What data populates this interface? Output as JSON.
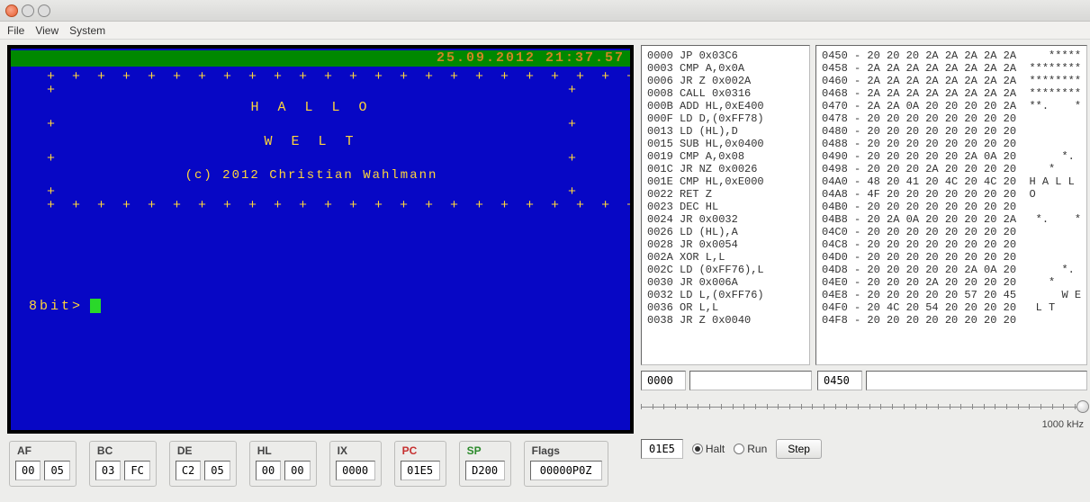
{
  "menubar": {
    "file": "File",
    "view": "View",
    "system": "System"
  },
  "screen": {
    "datetime": "25.09.2012 21:37.57",
    "line1": "H A L L O",
    "line2": "W E L T",
    "copyright": "(c) 2012 Christian Wahlmann",
    "prompt": "8bit>"
  },
  "registers": {
    "AF": {
      "label": "AF",
      "hi": "00",
      "lo": "05"
    },
    "BC": {
      "label": "BC",
      "hi": "03",
      "lo": "FC"
    },
    "DE": {
      "label": "DE",
      "hi": "C2",
      "lo": "05"
    },
    "HL": {
      "label": "HL",
      "hi": "00",
      "lo": "00"
    },
    "IX": {
      "label": "IX",
      "val": "0000"
    },
    "PC": {
      "label": "PC",
      "val": "01E5"
    },
    "SP": {
      "label": "SP",
      "val": "D200"
    },
    "Flags": {
      "label": "Flags",
      "val": "00000P0Z"
    }
  },
  "disasm": [
    "0000 JP 0x03C6",
    "0003 CMP A,0x0A",
    "0006 JR Z 0x002A",
    "0008 CALL 0x0316",
    "000B ADD HL,0xE400",
    "000F LD D,(0xFF78)",
    "0013 LD (HL),D",
    "0015 SUB HL,0x0400",
    "0019 CMP A,0x08",
    "001C JR NZ 0x0026",
    "001E CMP HL,0xE000",
    "0022 RET Z",
    "0023 DEC HL",
    "0024 JR 0x0032",
    "0026 LD (HL),A",
    "0028 JR 0x0054",
    "002A XOR L,L",
    "002C LD (0xFF76),L",
    "0030 JR 0x006A",
    "0032 LD L,(0xFF76)",
    "0036 OR L,L",
    "0038 JR Z 0x0040"
  ],
  "memdump": [
    "0450 - 20 20 20 2A 2A 2A 2A 2A     *****",
    "0458 - 2A 2A 2A 2A 2A 2A 2A 2A  ********",
    "0460 - 2A 2A 2A 2A 2A 2A 2A 2A  ********",
    "0468 - 2A 2A 2A 2A 2A 2A 2A 2A  ********",
    "0470 - 2A 2A 0A 20 20 20 20 2A  **.    *",
    "0478 - 20 20 20 20 20 20 20 20          ",
    "0480 - 20 20 20 20 20 20 20 20          ",
    "0488 - 20 20 20 20 20 20 20 20          ",
    "0490 - 20 20 20 20 20 2A 0A 20       *. ",
    "0498 - 20 20 20 2A 20 20 20 20     *    ",
    "04A0 - 48 20 41 20 4C 20 4C 20  H A L L ",
    "04A8 - 4F 20 20 20 20 20 20 20  O       ",
    "04B0 - 20 20 20 20 20 20 20 20          ",
    "04B8 - 20 2A 0A 20 20 20 20 2A   *.    *",
    "04C0 - 20 20 20 20 20 20 20 20          ",
    "04C8 - 20 20 20 20 20 20 20 20          ",
    "04D0 - 20 20 20 20 20 20 20 20          ",
    "04D8 - 20 20 20 20 20 2A 0A 20       *. ",
    "04E0 - 20 20 20 2A 20 20 20 20     *    ",
    "04E8 - 20 20 20 20 20 57 20 45       W E",
    "04F0 - 20 4C 20 54 20 20 20 20   L T    ",
    "04F8 - 20 20 20 20 20 20 20 20          "
  ],
  "addr": {
    "left": "0000",
    "right": "0450"
  },
  "speed": "1000 kHz",
  "controls": {
    "pc": "01E5",
    "halt": "Halt",
    "run": "Run",
    "step": "Step"
  }
}
